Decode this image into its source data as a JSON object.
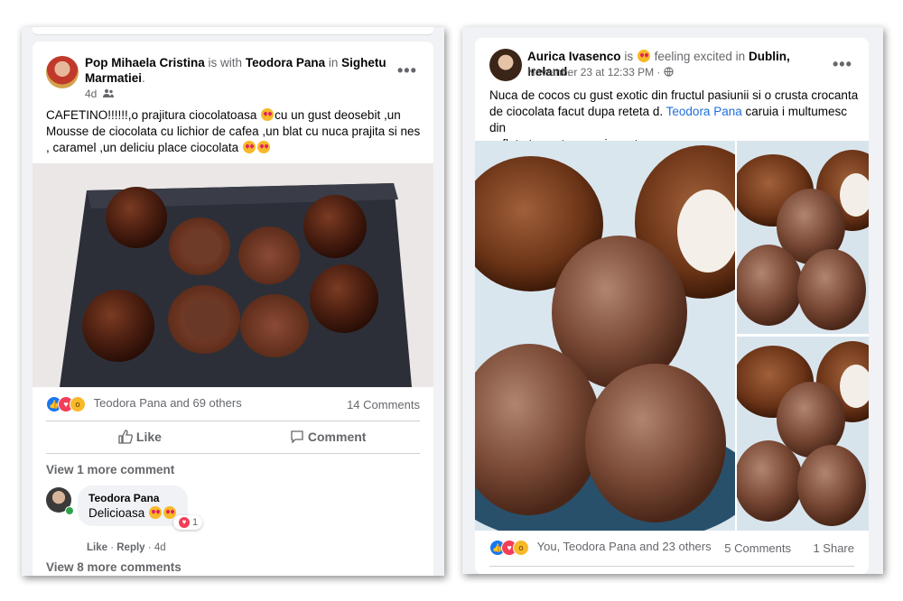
{
  "post1": {
    "author": "Pop Mihaela Cristina",
    "with_word": "is with",
    "tagged": "Teodora Pana",
    "in_word": "in",
    "place_line1": "Sighetu",
    "place_line2": "Marmatiei",
    "time": "4d",
    "text_line1": "CAFETINO!!!!!!,o prajitura   ciocolatoasa",
    "text_line1b": "cu un gust deosebit ,un",
    "text_line2": "Mousse  de ciocolata  cu lichior de cafea  ,un blat cu nuca prajita si nes",
    "text_line3": ", caramel ,un deliciu  place ciocolata",
    "reactions_text": "Teodora Pana and 69 others",
    "comments_count": "14 Comments",
    "like_label": "Like",
    "comment_label": "Comment",
    "view_more_1": "View 1 more comment",
    "comment": {
      "author": "Teodora Pana",
      "text": "Delicioasa",
      "reaction_count": "1",
      "like": "Like",
      "reply": "Reply",
      "time": "4d"
    },
    "view_more_8": "View 8 more comments"
  },
  "post2": {
    "author": "Aurica Ivasenco",
    "is_word": "is",
    "feeling": "feeling excited in",
    "place": "Dublin, Ireland",
    "time": "November 23 at 12:33 PM",
    "text_line1": "Nuca de cocos cu gust exotic din fructul pasiunii si o crusta crocanta",
    "text_line2a": "de ciocolata facut dupa reteta d.",
    "text_link": "Teodora Pana",
    "text_line2b": "caruia i multumesc din",
    "text_line3": "suflet pt acest curs minunat.",
    "reactions_text": "You, Teodora Pana and 23 others",
    "comments_count": "5 Comments",
    "shares": "1 Share"
  },
  "colors": {
    "link": "#216fdb",
    "like_blue": "#1877f2",
    "love_red": "#f33e58",
    "wow_yellow": "#f7b928",
    "secondary_text": "#65676b"
  },
  "icons": {
    "more": "more-dots-icon",
    "friends": "friends-icon",
    "globe": "globe-icon",
    "like": "thumbs-up-icon",
    "comment": "speech-bubble-icon"
  }
}
